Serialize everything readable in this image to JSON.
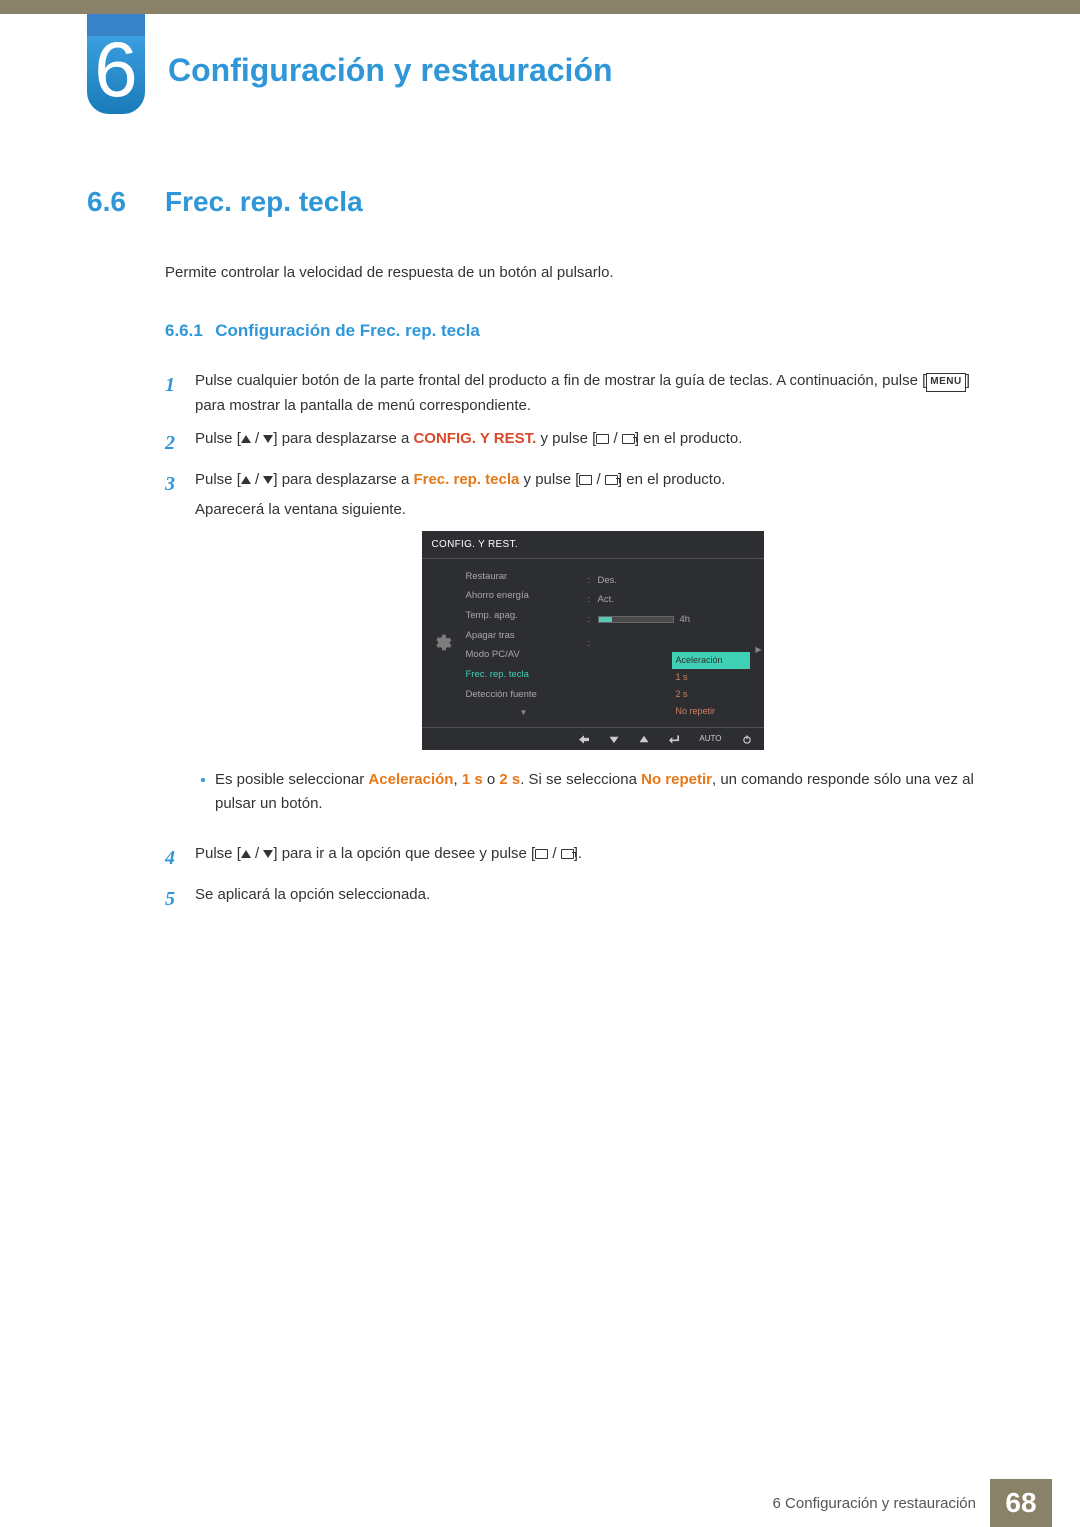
{
  "chapter": {
    "number": "6",
    "title": "Configuración y restauración"
  },
  "section": {
    "number": "6.6",
    "title": "Frec. rep. tecla",
    "desc": "Permite controlar la velocidad de respuesta de un botón al pulsarlo."
  },
  "subsection": {
    "number": "6.6.1",
    "title": "Configuración de Frec. rep. tecla"
  },
  "steps": {
    "s1_a": "Pulse cualquier botón de la parte frontal del producto a fin de mostrar la guía de teclas. A continuación, pulse [",
    "s1_menu": "MENU",
    "s1_b": "] para mostrar la pantalla de menú correspondiente.",
    "s2_a": "Pulse [",
    "s2_b": "] para desplazarse a ",
    "s2_target": "CONFIG. Y REST.",
    "s2_c": " y pulse [",
    "s2_d": "] en el producto.",
    "s3_a": "Pulse [",
    "s3_b": "] para desplazarse a ",
    "s3_target": "Frec. rep. tecla",
    "s3_c": " y pulse [",
    "s3_d": "] en el producto.",
    "s3_after": "Aparecerá la ventana siguiente.",
    "bullet_a": "Es posible seleccionar ",
    "bullet_opt1": "Aceleración",
    "bullet_sep1": ", ",
    "bullet_opt2": "1 s",
    "bullet_sep2": " o ",
    "bullet_opt3": "2 s",
    "bullet_b": ". Si se selecciona ",
    "bullet_opt4": "No repetir",
    "bullet_c": ", un comando responde sólo una vez al pulsar un botón.",
    "s4_a": "Pulse [",
    "s4_b": "] para ir a la opción que desee y pulse [",
    "s4_c": "].",
    "s5": "Se aplicará la opción seleccionada.",
    "n1": "1",
    "n2": "2",
    "n3": "3",
    "n4": "4",
    "n5": "5"
  },
  "osd": {
    "header": "CONFIG. Y REST.",
    "items": {
      "i0": "Restaurar",
      "i1": "Ahorro energía",
      "i2": "Temp. apag.",
      "i3": "Apagar tras",
      "i4": "Modo PC/AV",
      "i5": "Frec. rep. tecla",
      "i6": "Detección fuente"
    },
    "vals": {
      "v1": "Des.",
      "v2": "Act.",
      "v3": "4h"
    },
    "popup": {
      "p0": "Aceleración",
      "p1": "1 s",
      "p2": "2 s",
      "p3": "No repetir"
    },
    "footer_auto": "AUTO"
  },
  "footer": {
    "text": "6 Configuración y restauración",
    "page": "68"
  }
}
